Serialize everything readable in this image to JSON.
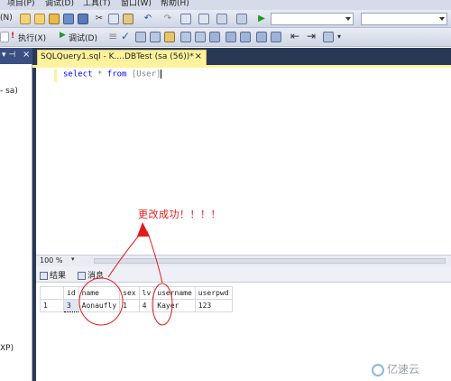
{
  "menu": {
    "items": [
      "项目(P)",
      "调试(D)",
      "工具(T)",
      "窗口(W)",
      "帮助(H)"
    ],
    "left_cut": "(N)"
  },
  "toolbar2": {
    "execute_label": "执行(X)",
    "debug_label": "调试(D)"
  },
  "object_explorer": {
    "connection_label": "- sa)",
    "node_label": "XP)"
  },
  "document": {
    "tab_title": "SQLQuery1.sql - K....DBTest (sa (56))*",
    "close_glyph": "×",
    "query_keyword_select": "select",
    "query_star": "*",
    "query_keyword_from": "from",
    "query_table": "[User]"
  },
  "annotation": {
    "text": "更改成功！！！！",
    "color": "#e51a1a"
  },
  "zoom": {
    "value": "100 %"
  },
  "results_tabs": {
    "results_label": "结果",
    "messages_label": "消息"
  },
  "result_grid": {
    "columns": [
      "id",
      "name",
      "sex",
      "lv",
      "username",
      "userpwd"
    ],
    "rows": [
      {
        "row_number": "1",
        "id": "3",
        "name": "Aonaufly",
        "sex": "1",
        "lv": "4",
        "username": "Kayer",
        "userpwd": "123"
      }
    ]
  },
  "watermark": {
    "text": "亿速云"
  },
  "colors": {
    "tab_active": "#fff29d",
    "doc_background": "#293955",
    "keyword_blue": "#0000ff"
  }
}
